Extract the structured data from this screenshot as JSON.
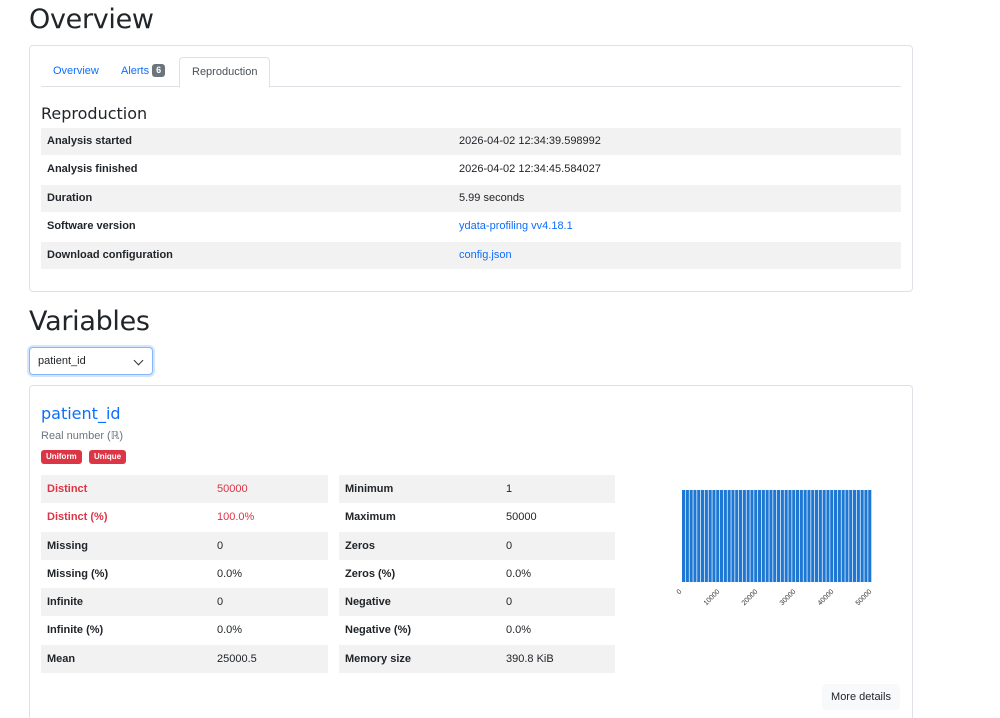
{
  "overview": {
    "title": "Overview",
    "tabs": [
      {
        "label": "Overview"
      },
      {
        "label": "Alerts",
        "badge": "6"
      },
      {
        "label": "Reproduction"
      }
    ],
    "section_title": "Reproduction",
    "rows": [
      {
        "key": "Analysis started",
        "value": "2026-04-02 12:34:39.598992"
      },
      {
        "key": "Analysis finished",
        "value": "2026-04-02 12:34:45.584027"
      },
      {
        "key": "Duration",
        "value": "5.99 seconds"
      },
      {
        "key": "Software version",
        "value": "ydata-profiling vv4.18.1"
      },
      {
        "key": "Download configuration",
        "value": "config.json"
      }
    ]
  },
  "variables": {
    "title": "Variables",
    "select_value": "patient_id",
    "var_name": "patient_id",
    "var_type": "Real number (ℝ)",
    "tags": [
      "Uniform",
      "Unique"
    ],
    "left_stats": [
      {
        "key": "Distinct",
        "value": "50000"
      },
      {
        "key": "Distinct (%)",
        "value": "100.0%"
      },
      {
        "key": "Missing",
        "value": "0"
      },
      {
        "key": "Missing (%)",
        "value": "0.0%"
      },
      {
        "key": "Infinite",
        "value": "0"
      },
      {
        "key": "Infinite (%)",
        "value": "0.0%"
      },
      {
        "key": "Mean",
        "value": "25000.5"
      }
    ],
    "right_stats": [
      {
        "key": "Minimum",
        "value": "1"
      },
      {
        "key": "Maximum",
        "value": "50000"
      },
      {
        "key": "Zeros",
        "value": "0"
      },
      {
        "key": "Zeros (%)",
        "value": "0.0%"
      },
      {
        "key": "Negative",
        "value": "0"
      },
      {
        "key": "Negative (%)",
        "value": "0.0%"
      },
      {
        "key": "Memory size",
        "value": "390.8 KiB"
      }
    ],
    "more_details": "More details",
    "alert_color": "#dc3545",
    "bar_color": "#1f77d4"
  },
  "chart_data": {
    "type": "bar",
    "bins": 50,
    "x_ticks": [
      "0",
      "10000",
      "20000",
      "30000",
      "40000",
      "50000"
    ],
    "xlim": [
      0,
      50000
    ],
    "values_per_bin": 1000,
    "ylim": [
      0,
      1000
    ]
  }
}
